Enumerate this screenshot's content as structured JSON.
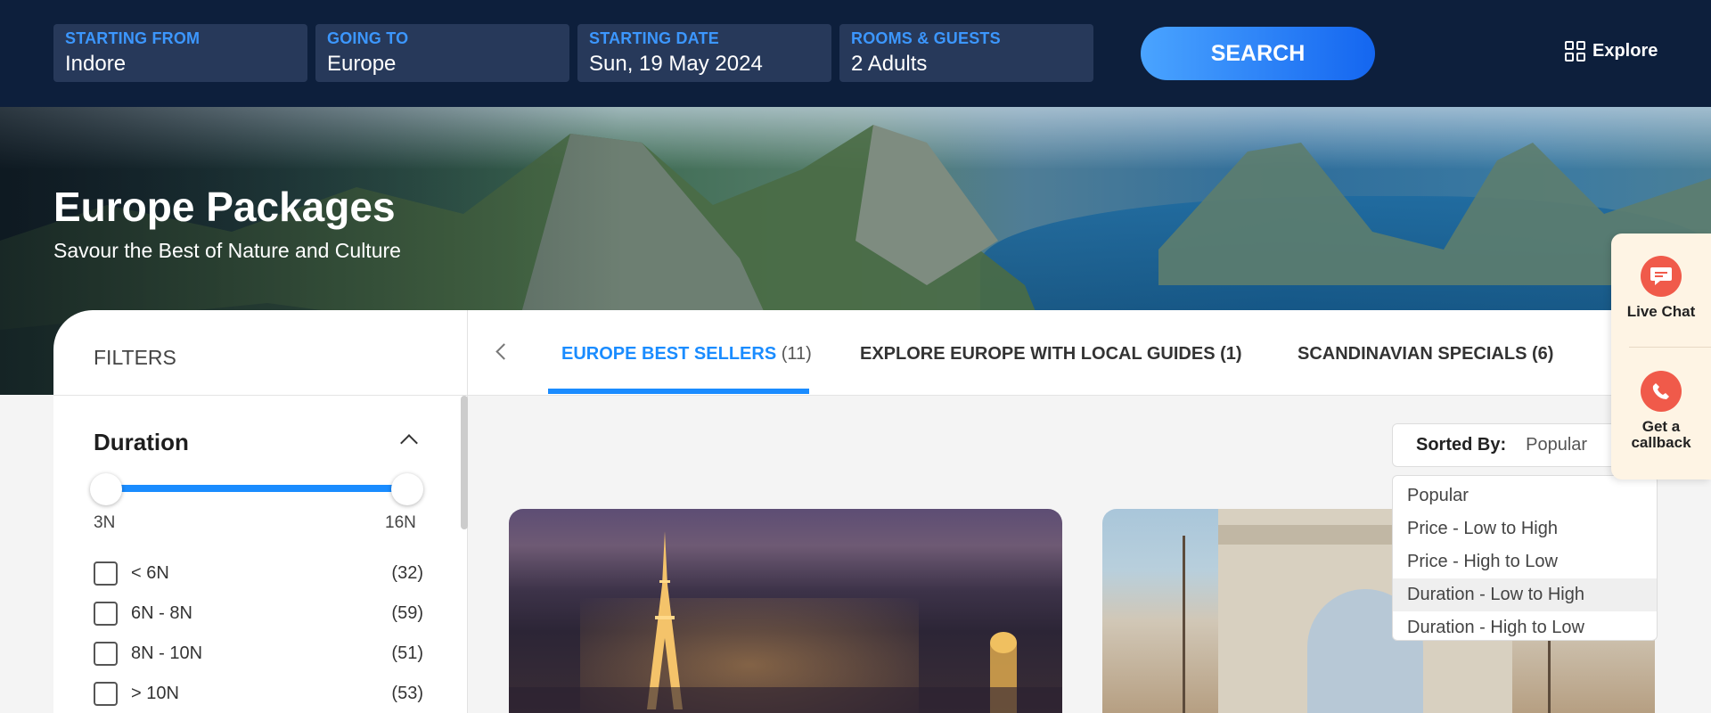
{
  "search": {
    "starting_from": {
      "label": "STARTING FROM",
      "value": "Indore"
    },
    "going_to": {
      "label": "GOING TO",
      "value": "Europe"
    },
    "starting_date": {
      "label": "STARTING DATE",
      "value": "Sun, 19 May 2024"
    },
    "rooms_guests": {
      "label": "ROOMS & GUESTS",
      "value": "2 Adults"
    },
    "button": "SEARCH",
    "explore": "Explore"
  },
  "hero": {
    "title": "Europe Packages",
    "subtitle": "Savour the Best of Nature and Culture"
  },
  "filters": {
    "title": "FILTERS",
    "duration": {
      "title": "Duration",
      "min_label": "3N",
      "max_label": "16N",
      "options": [
        {
          "label": "< 6N",
          "count": "(32)"
        },
        {
          "label": "6N - 8N",
          "count": "(59)"
        },
        {
          "label": "8N - 10N",
          "count": "(51)"
        },
        {
          "label": "> 10N",
          "count": "(53)"
        }
      ]
    }
  },
  "tabs": [
    {
      "label": "EUROPE BEST SELLERS",
      "count": "(11)",
      "active": true
    },
    {
      "label": "EXPLORE EUROPE WITH LOCAL GUIDES",
      "count": "(1)",
      "active": false
    },
    {
      "label": "SCANDINAVIAN SPECIALS",
      "count": "(6)",
      "active": false
    }
  ],
  "sort": {
    "label": "Sorted By:",
    "value": "Popular",
    "options": [
      "Popular",
      "Price - Low to High",
      "Price - High to Low",
      "Duration - Low to High",
      "Duration - High to Low"
    ],
    "highlighted": "Duration - Low to High"
  },
  "widget": {
    "live_chat": "Live Chat",
    "callback": "Get a callback"
  },
  "colors": {
    "navy": "#0d1f3c",
    "accent": "#1a8cff",
    "widget_bg": "#fef4e4",
    "widget_icon": "#f05a4a"
  }
}
